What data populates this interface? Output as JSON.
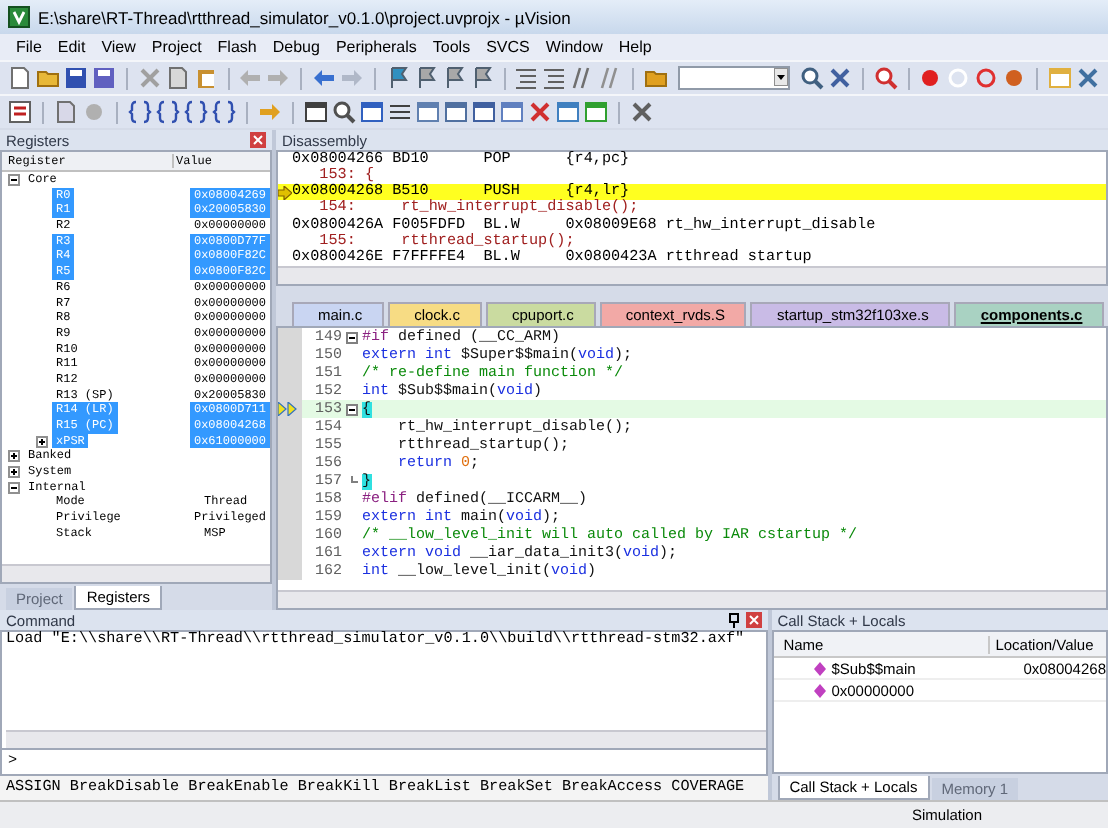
{
  "window": {
    "title": "E:\\share\\RT-Thread\\rtthread_simulator_v0.1.0\\project.uvprojx - µVision"
  },
  "menu": [
    "File",
    "Edit",
    "View",
    "Project",
    "Flash",
    "Debug",
    "Peripherals",
    "Tools",
    "SVCS",
    "Window",
    "Help"
  ],
  "registers": {
    "title": "Registers",
    "columns": [
      "Register",
      "Value"
    ],
    "tree": [
      {
        "name": "Core",
        "expanded": true,
        "children": [
          {
            "name": "R0",
            "value": "0x08004269",
            "selected": true
          },
          {
            "name": "R1",
            "value": "0x20005830",
            "selected": true
          },
          {
            "name": "R2",
            "value": "0x00000000",
            "selected": false
          },
          {
            "name": "R3",
            "value": "0x0800D77F",
            "selected": true
          },
          {
            "name": "R4",
            "value": "0x0800F82C",
            "selected": true
          },
          {
            "name": "R5",
            "value": "0x0800F82C",
            "selected": true
          },
          {
            "name": "R6",
            "value": "0x00000000",
            "selected": false
          },
          {
            "name": "R7",
            "value": "0x00000000",
            "selected": false
          },
          {
            "name": "R8",
            "value": "0x00000000",
            "selected": false
          },
          {
            "name": "R9",
            "value": "0x00000000",
            "selected": false
          },
          {
            "name": "R10",
            "value": "0x00000000",
            "selected": false
          },
          {
            "name": "R11",
            "value": "0x00000000",
            "selected": false
          },
          {
            "name": "R12",
            "value": "0x00000000",
            "selected": false
          },
          {
            "name": "R13  (SP)",
            "value": "0x20005830",
            "selected": false
          },
          {
            "name": "R14  (LR)",
            "value": "0x0800D711",
            "selected": true
          },
          {
            "name": "R15  (PC)",
            "value": "0x08004268",
            "selected": true
          },
          {
            "name": "xPSR",
            "value": "0x61000000",
            "selected": true,
            "expanded": false
          }
        ]
      },
      {
        "name": "Banked",
        "expanded": false
      },
      {
        "name": "System",
        "expanded": false
      },
      {
        "name": "Internal",
        "expanded": true,
        "children": [
          {
            "name": "Mode",
            "value": "Thread",
            "selected": false
          },
          {
            "name": "Privilege",
            "value": "Privileged",
            "selected": false
          },
          {
            "name": "Stack",
            "value": "MSP",
            "selected": false
          }
        ]
      }
    ],
    "tabs": [
      {
        "label": "Project",
        "selected": false
      },
      {
        "label": "Registers",
        "selected": true
      }
    ]
  },
  "disassembly": {
    "title": "Disassembly",
    "lines": [
      {
        "kind": "asm",
        "text": "0x08004266 BD10      POP      {r4,pc}",
        "current": false
      },
      {
        "kind": "src",
        "text": "   153: {",
        "current": false
      },
      {
        "kind": "asm",
        "text": "0x08004268 B510      PUSH     {r4,lr}",
        "current": true
      },
      {
        "kind": "src",
        "text": "   154:     rt_hw_interrupt_disable();",
        "current": false
      },
      {
        "kind": "asm",
        "text": "0x0800426A F005FDFD  BL.W     0x08009E68 rt_hw_interrupt_disable",
        "current": false
      },
      {
        "kind": "src",
        "text": "   155:     rtthread_startup();",
        "current": false
      },
      {
        "kind": "asm",
        "text": "0x0800426E F7FFFFE4  BL.W     0x0800423A rtthread startup",
        "current": false
      }
    ]
  },
  "file_tabs": [
    {
      "label": "main.c",
      "color": "#c9d5f2",
      "selected": false
    },
    {
      "label": "clock.c",
      "color": "#f7dc84",
      "selected": false
    },
    {
      "label": "cpuport.c",
      "color": "#cadba0",
      "selected": false
    },
    {
      "label": "context_rvds.S",
      "color": "#f2a9a6",
      "selected": false
    },
    {
      "label": "startup_stm32f103xe.s",
      "color": "#c9bbe6",
      "selected": false
    },
    {
      "label": "components.c",
      "color": "#a9d2c2",
      "selected": true
    }
  ],
  "code": [
    {
      "number": "149",
      "foldable": true,
      "current": false,
      "tokens": [
        {
          "kind": "pre",
          "text": "#if"
        },
        {
          "kind": "plain",
          "text": " defined (__CC_ARM)"
        }
      ]
    },
    {
      "number": "150",
      "current": false,
      "tokens": [
        {
          "kind": "kw",
          "text": "extern int"
        },
        {
          "kind": "plain",
          "text": " $Super$$main("
        },
        {
          "kind": "kw",
          "text": "void"
        },
        {
          "kind": "plain",
          "text": ");"
        }
      ]
    },
    {
      "number": "151",
      "current": false,
      "tokens": [
        {
          "kind": "comment",
          "text": "/* re-define main function */"
        }
      ]
    },
    {
      "number": "152",
      "current": false,
      "tokens": [
        {
          "kind": "kw",
          "text": "int"
        },
        {
          "kind": "plain",
          "text": " $Sub$$main("
        },
        {
          "kind": "kw",
          "text": "void"
        },
        {
          "kind": "plain",
          "text": ")"
        }
      ]
    },
    {
      "number": "153",
      "foldable": true,
      "current": true,
      "tokens": [
        {
          "kind": "brace",
          "text": "{"
        }
      ]
    },
    {
      "number": "154",
      "current": false,
      "tokens": [
        {
          "kind": "plain",
          "text": "    rt_hw_interrupt_disable();"
        }
      ]
    },
    {
      "number": "155",
      "current": false,
      "tokens": [
        {
          "kind": "plain",
          "text": "    rtthread_startup();"
        }
      ]
    },
    {
      "number": "156",
      "current": false,
      "tokens": [
        {
          "kind": "kw",
          "text": "    return"
        },
        {
          "kind": "num",
          "text": " 0"
        },
        {
          "kind": "plain",
          "text": ";"
        }
      ]
    },
    {
      "number": "157",
      "block_end": true,
      "current": false,
      "tokens": [
        {
          "kind": "brace",
          "text": "}"
        }
      ]
    },
    {
      "number": "158",
      "current": false,
      "tokens": [
        {
          "kind": "pre",
          "text": "#elif"
        },
        {
          "kind": "plain",
          "text": " defined(__ICCARM__)"
        }
      ]
    },
    {
      "number": "159",
      "current": false,
      "tokens": [
        {
          "kind": "kw",
          "text": "extern int"
        },
        {
          "kind": "plain",
          "text": " main("
        },
        {
          "kind": "kw",
          "text": "void"
        },
        {
          "kind": "plain",
          "text": ");"
        }
      ]
    },
    {
      "number": "160",
      "current": false,
      "tokens": [
        {
          "kind": "comment",
          "text": "/* __low_level_init will auto called by IAR cstartup */"
        }
      ]
    },
    {
      "number": "161",
      "current": false,
      "tokens": [
        {
          "kind": "kw",
          "text": "extern void"
        },
        {
          "kind": "plain",
          "text": " __iar_data_init3("
        },
        {
          "kind": "kw",
          "text": "void"
        },
        {
          "kind": "plain",
          "text": ");"
        }
      ]
    },
    {
      "number": "162",
      "current": false,
      "tokens": [
        {
          "kind": "kw",
          "text": "int"
        },
        {
          "kind": "plain",
          "text": " __low_level_init("
        },
        {
          "kind": "kw",
          "text": "void"
        },
        {
          "kind": "plain",
          "text": ")"
        }
      ]
    }
  ],
  "command": {
    "title": "Command",
    "output": "Load \"E:\\\\share\\\\RT-Thread\\\\rtthread_simulator_v0.1.0\\\\build\\\\rtthread-stm32.axf\"",
    "prompt": ">",
    "hint": "ASSIGN BreakDisable BreakEnable BreakKill BreakList BreakSet BreakAccess COVERAGE"
  },
  "call_stack": {
    "title": "Call Stack + Locals",
    "columns": [
      "Name",
      "Location/Value"
    ],
    "rows": [
      {
        "name": "$Sub$$main",
        "value": "0x08004268"
      },
      {
        "name": "0x00000000"
      }
    ],
    "tabs": [
      {
        "label": "Call Stack + Locals",
        "selected": true
      },
      {
        "label": "Memory 1",
        "selected": false
      }
    ]
  },
  "status_bar": {
    "mode": "Simulation"
  }
}
